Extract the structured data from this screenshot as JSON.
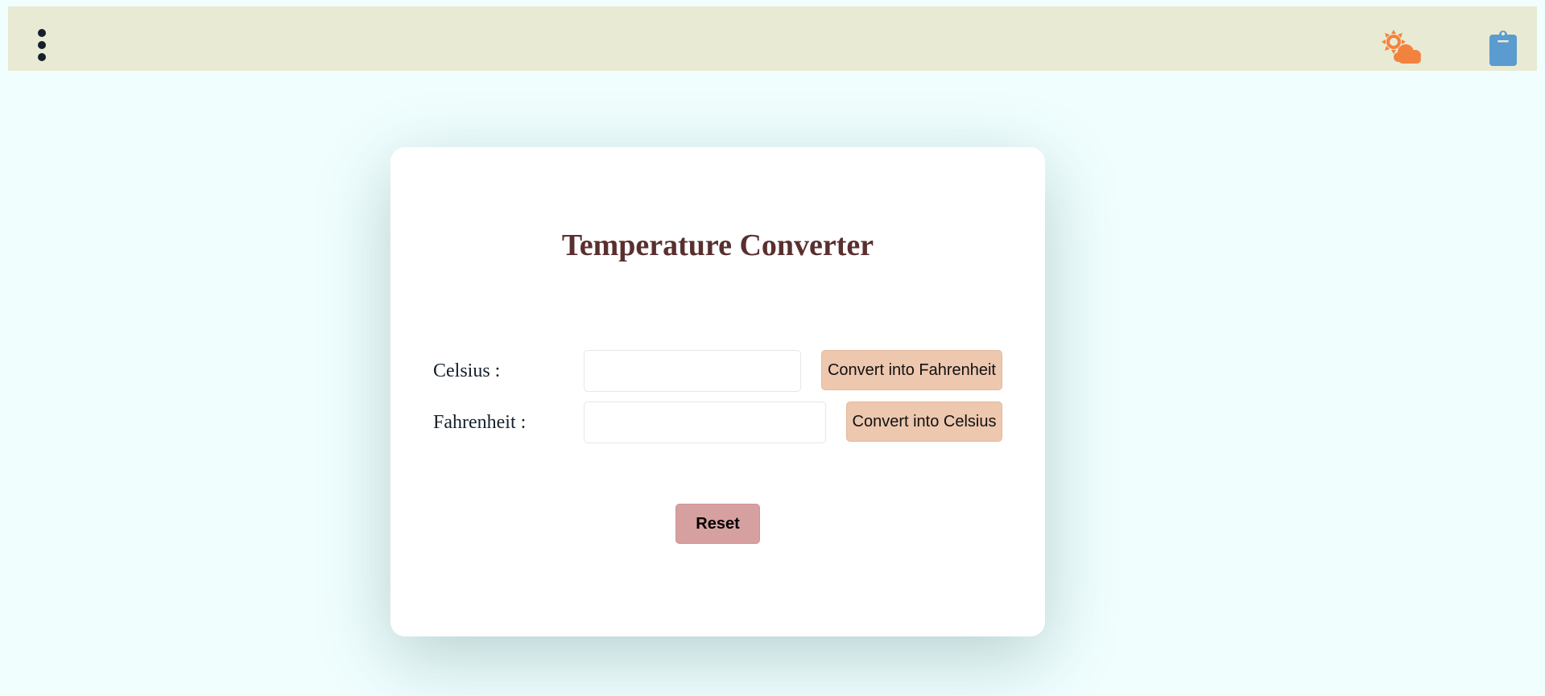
{
  "header": {
    "menu_icon": "vertical-dots-icon",
    "weather_icon": "sun-cloud-icon",
    "clipboard_icon": "clipboard-icon",
    "colors": {
      "bar_bg": "#e9ead3",
      "weather_icon": "#f2833e",
      "clipboard_icon": "#5a9bd0"
    }
  },
  "converter": {
    "title": "Temperature Converter",
    "celsius_label": "Celsius :",
    "celsius_value": "",
    "fahrenheit_label": "Fahrenheit :",
    "fahrenheit_value": "",
    "to_fahrenheit_button": "Convert into Fahrenheit",
    "to_celsius_button": "Convert into Celsius",
    "reset_button": "Reset"
  },
  "colors": {
    "page_bg": "#f0fefe",
    "title": "#5a2f2f",
    "convert_button": "#edc7ae",
    "reset_button": "#d7a0a0"
  }
}
